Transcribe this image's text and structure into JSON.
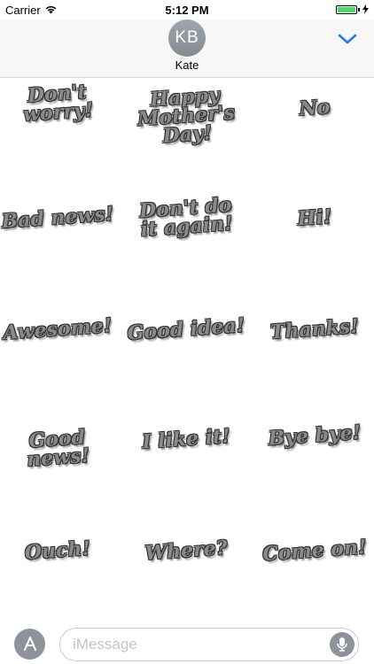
{
  "status_bar": {
    "carrier": "Carrier",
    "time": "5:12 PM",
    "wifi_icon": "wifi-icon",
    "battery_icon": "battery-icon",
    "charging_icon": "charging-icon",
    "battery_level": 1.0
  },
  "header": {
    "avatar_initials": "KB",
    "contact_name": "Kate",
    "collapse_icon": "chevron-down-icon",
    "accent_color": "#1e7cf0"
  },
  "stickers": [
    [
      "Don't\nworry!",
      "Happy\nMother's Day!",
      "No"
    ],
    [
      "Bad news!",
      "Don't do\nit again!",
      "Hi!"
    ],
    [
      "Awesome!",
      "Good idea!",
      "Thanks!"
    ],
    [
      "Good news!",
      "I like it!",
      "Bye bye!"
    ],
    [
      "Ouch!",
      "Where?",
      "Come on!"
    ]
  ],
  "input_bar": {
    "app_store_icon": "app-store-icon",
    "placeholder": "iMessage",
    "mic_icon": "microphone-icon"
  }
}
